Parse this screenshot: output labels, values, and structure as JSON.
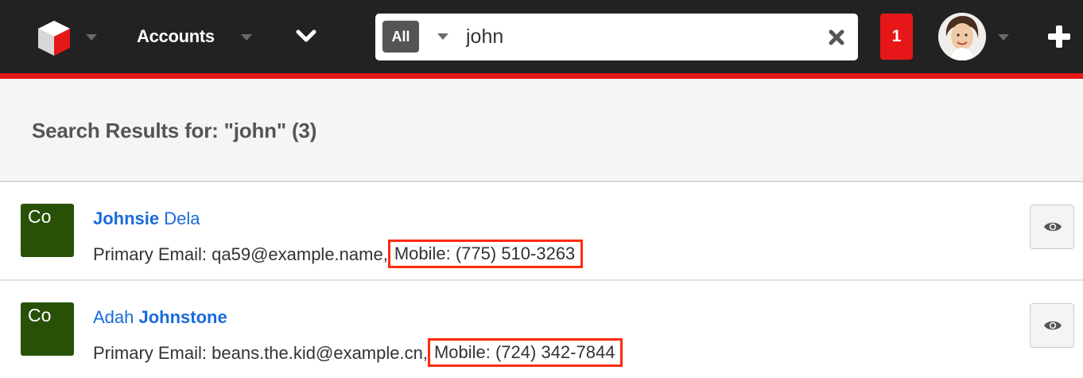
{
  "navbar": {
    "module_label": "Accounts",
    "notification_count": "1",
    "colors": {
      "bar": "#222222",
      "accent": "#e61718"
    }
  },
  "search": {
    "scope_label": "All",
    "query": "john"
  },
  "results": {
    "title": "Search Results for: \"john\" (3)",
    "items": [
      {
        "badge": "Co",
        "name_bold": "Johnsie",
        "name_rest": " Dela",
        "bold_first": true,
        "email_prefix": "Primary Email: qa59@example.name,",
        "mobile": "Mobile: (775) 510-3263"
      },
      {
        "badge": "Co",
        "name_rest": "Adah ",
        "name_bold": "Johnstone",
        "bold_first": false,
        "email_prefix": "Primary Email: beans.the.kid@example.cn,",
        "mobile": "Mobile: (724) 342-7844"
      }
    ]
  },
  "icons": [
    "logo-cube-icon",
    "chevron-down-icon",
    "close-icon",
    "user-avatar",
    "plus-icon",
    "eye-icon"
  ]
}
